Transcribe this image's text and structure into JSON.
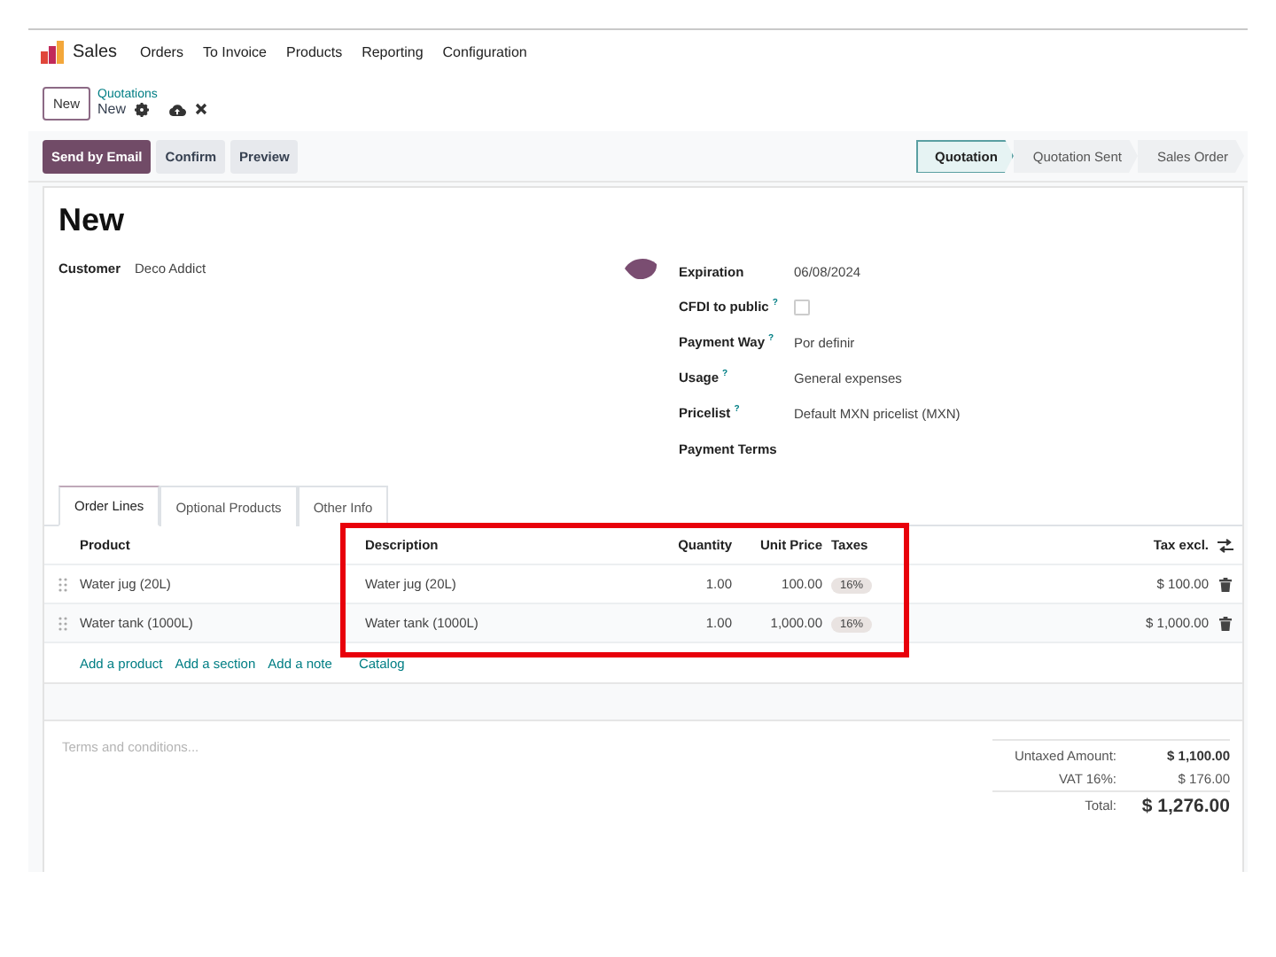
{
  "app": {
    "name": "Sales"
  },
  "menu": [
    "Orders",
    "To Invoice",
    "Products",
    "Reporting",
    "Configuration"
  ],
  "breadcrumb": {
    "new_button": "New",
    "parent": "Quotations",
    "current": "New"
  },
  "actions": [
    {
      "label": "Send by Email",
      "primary": true
    },
    {
      "label": "Confirm",
      "primary": false
    },
    {
      "label": "Preview",
      "primary": false
    }
  ],
  "stages": [
    {
      "label": "Quotation",
      "selected": true
    },
    {
      "label": "Quotation Sent",
      "selected": false
    },
    {
      "label": "Sales Order",
      "selected": false
    }
  ],
  "record": {
    "title": "New",
    "customer_label": "Customer",
    "customer": "Deco Addict"
  },
  "fields": [
    {
      "label": "Expiration",
      "kind": "text",
      "value": "06/08/2024"
    },
    {
      "label": "CFDI to public",
      "help": "?",
      "kind": "checkbox",
      "checked": false
    },
    {
      "label": "Payment Way",
      "help": "?",
      "kind": "text",
      "value": "Por definir"
    },
    {
      "label": "Usage",
      "help": "?",
      "kind": "text",
      "value": "General expenses"
    },
    {
      "label": "Pricelist",
      "help": "?",
      "kind": "text",
      "value": "Default MXN pricelist (MXN)"
    },
    {
      "label": "Payment Terms",
      "kind": "text"
    }
  ],
  "tabs": [
    {
      "label": "Order Lines",
      "selected": true
    },
    {
      "label": "Optional Products",
      "selected": false
    },
    {
      "label": "Other Info",
      "selected": false
    }
  ],
  "table": {
    "columns": [
      "Product",
      "Description",
      "Quantity",
      "Unit Price",
      "Taxes",
      "Tax excl."
    ],
    "rows": [
      {
        "product": "Water jug (20L)",
        "description": "Water jug (20L)",
        "quantity": "1.00",
        "unit_price": "100.00",
        "taxes": [
          "16%"
        ],
        "subtotal": "$ 100.00"
      },
      {
        "product": "Water tank (1000L)",
        "description": "Water tank (1000L)",
        "quantity": "1.00",
        "unit_price": "1,000.00",
        "taxes": [
          "16%"
        ],
        "subtotal": "$ 1,000.00"
      }
    ],
    "add_links": [
      "Add a product",
      "Add a section",
      "Add a note",
      "Catalog"
    ]
  },
  "highlight": {
    "kind": "frame"
  },
  "terms": {
    "placeholder": "Terms and conditions..."
  },
  "totals": [
    {
      "label": "Untaxed Amount:",
      "value": "$ 1,100.00",
      "kind": "subtotal"
    },
    {
      "label": "VAT 16%:",
      "value": "$ 176.00",
      "kind": "tax"
    },
    {
      "label": "Total:",
      "value": "$ 1,276.00",
      "kind": "total"
    }
  ]
}
